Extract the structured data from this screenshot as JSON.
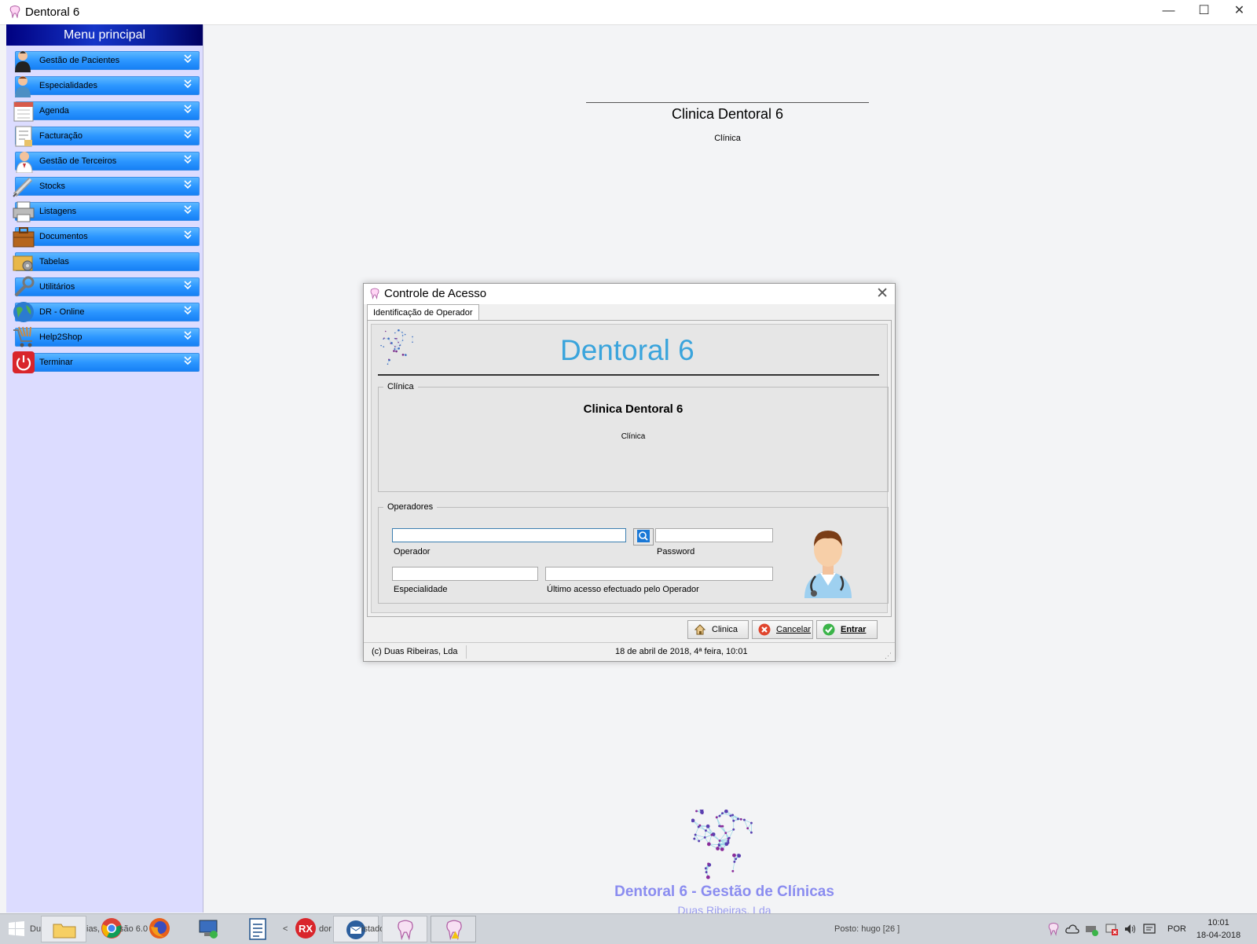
{
  "window": {
    "title": "Dentoral 6",
    "minimize": "—",
    "maximize": "☐",
    "close": "✕"
  },
  "sidebar": {
    "header": "Menu principal",
    "items": [
      {
        "label": "Gestão de Pacientes",
        "icon": "patient-icon"
      },
      {
        "label": "Especialidades",
        "icon": "specialist-icon"
      },
      {
        "label": "Agenda",
        "icon": "calendar-icon"
      },
      {
        "label": "Facturação",
        "icon": "invoice-icon"
      },
      {
        "label": "Gestão de Terceiros",
        "icon": "third-party-icon"
      },
      {
        "label": "Stocks",
        "icon": "syringe-icon"
      },
      {
        "label": "Listagens",
        "icon": "printer-icon"
      },
      {
        "label": "Documentos",
        "icon": "briefcase-icon"
      },
      {
        "label": "Tabelas",
        "icon": "gear-folder-icon"
      },
      {
        "label": "Utilitários",
        "icon": "wrench-icon"
      },
      {
        "label": "DR - Online",
        "icon": "globe-icon"
      },
      {
        "label": "Help2Shop",
        "icon": "cart-icon"
      },
      {
        "label": "Terminar",
        "icon": "power-icon"
      }
    ]
  },
  "header": {
    "clinic_name": "Clinica Dentoral 6",
    "clinic_type": "Clínica"
  },
  "dialog": {
    "title": "Controle de Acesso",
    "tab": "Identificação de Operador",
    "brand": "Dentoral 6",
    "clinica_legend": "Clínica",
    "clinic_name": "Clinica Dentoral 6",
    "clinic_type": "Clínica",
    "operadores_legend": "Operadores",
    "operador_label": "Operador",
    "operador_value": "",
    "password_label": "Password",
    "password_value": "",
    "especialidade_label": "Especialidade",
    "especialidade_value": "",
    "ultimo_acesso_label": "Último acesso efectuado pelo Operador",
    "ultimo_acesso_value": "",
    "btn_clinica": "Clinica",
    "btn_cancelar": "Cancelar",
    "btn_entrar": "Entrar",
    "status_company": "(c) Duas Ribeiras, Lda",
    "status_datetime": "18 de abril de 2018, 4ª feira, 10:01"
  },
  "footer": {
    "title": "Dentoral 6 - Gestão de Clínicas",
    "company": "Duas Ribeiras, Lda"
  },
  "taskbar": {
    "behind_text_1": "Duas",
    "behind_text_2": "ias, Lda",
    "behind_text_3": "são 6.0",
    "behind_text_4": "<",
    "behind_text_5": "dor não",
    "behind_text_6": "istado",
    "posto": "Posto: hugo [26 ]",
    "language": "POR",
    "time": "10:01",
    "date": "18-04-2018"
  },
  "colors": {
    "menu_bar": "#2c96ff",
    "brand": "#3aa4dc",
    "footer_title": "#8a8cf0",
    "sidebar_bg": "#dcdcff"
  }
}
